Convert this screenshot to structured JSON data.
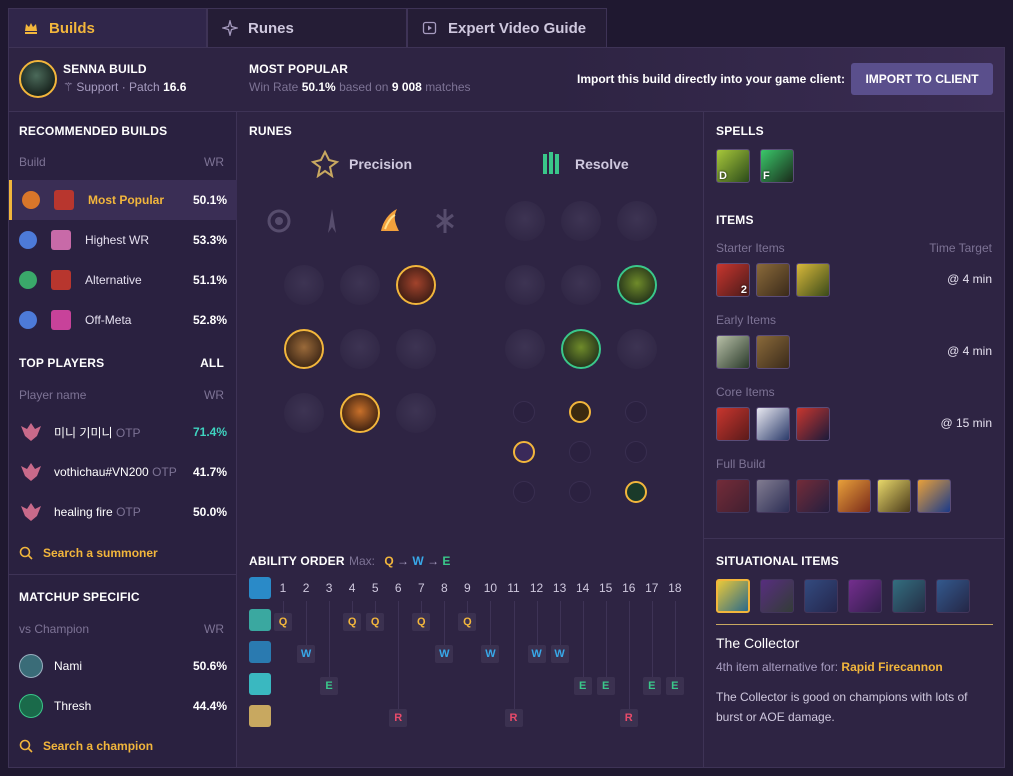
{
  "tabs": [
    {
      "label": "Builds",
      "icon": "crown-icon",
      "active": true
    },
    {
      "label": "Runes",
      "icon": "rune-icon",
      "active": false
    },
    {
      "label": "Expert Video Guide",
      "icon": "video-icon",
      "active": false
    }
  ],
  "header": {
    "champion_build": "SENNA BUILD",
    "role": "Support",
    "patch_label": "Patch",
    "patch": "16.6",
    "popular_title": "MOST POPULAR",
    "winrate_label": "Win Rate",
    "winrate": "50.1%",
    "based_on": "based on",
    "matches_count": "9 008",
    "matches_label": "matches",
    "import_text": "Import this build directly into your game client:",
    "import_button": "IMPORT TO CLIENT"
  },
  "recommended": {
    "title": "RECOMMENDED BUILDS",
    "col_build": "Build",
    "col_wr": "WR",
    "rows": [
      {
        "label": "Most Popular",
        "wr": "50.1%"
      },
      {
        "label": "Highest WR",
        "wr": "53.3%"
      },
      {
        "label": "Alternative",
        "wr": "51.1%"
      },
      {
        "label": "Off-Meta",
        "wr": "52.8%"
      }
    ]
  },
  "top_players": {
    "title": "TOP PLAYERS",
    "all_link": "ALL",
    "col_name": "Player name",
    "col_wr": "WR",
    "rows": [
      {
        "name": "미니 기미니",
        "tag": "OTP",
        "wr": "71.4%",
        "wr_color": "#3fd4c0"
      },
      {
        "name": "vothichau#VN200",
        "tag": "OTP",
        "wr": "41.7%",
        "wr_color": "#ffffff"
      },
      {
        "name": "healing fire",
        "tag": "OTP",
        "wr": "50.0%",
        "wr_color": "#ffffff"
      }
    ],
    "search": "Search a summoner"
  },
  "matchup": {
    "title": "MATCHUP SPECIFIC",
    "col_vs": "vs Champion",
    "col_wr": "WR",
    "rows": [
      {
        "name": "Nami",
        "wr": "50.6%"
      },
      {
        "name": "Thresh",
        "wr": "44.4%"
      }
    ],
    "search": "Search a champion"
  },
  "runes": {
    "title": "RUNES",
    "primary": "Precision",
    "secondary": "Resolve"
  },
  "ability": {
    "title": "ABILITY ORDER",
    "max_label": "Max:",
    "max_order": [
      "Q",
      "W",
      "E"
    ],
    "levels": [
      "1",
      "2",
      "3",
      "4",
      "5",
      "6",
      "7",
      "8",
      "9",
      "10",
      "11",
      "12",
      "13",
      "14",
      "15",
      "16",
      "17",
      "18"
    ]
  },
  "spells": {
    "title": "SPELLS",
    "keys": [
      "D",
      "F"
    ]
  },
  "items": {
    "title": "ITEMS",
    "starter_label": "Starter Items",
    "time_target_label": "Time Target",
    "starter_time": "@ 4 min",
    "starter_count": "2",
    "early_label": "Early Items",
    "early_time": "@ 4 min",
    "core_label": "Core Items",
    "core_time": "@ 15 min",
    "full_label": "Full Build"
  },
  "situational": {
    "title": "SITUATIONAL ITEMS",
    "item_name": "The Collector",
    "alt_prefix": "4th item alternative for:",
    "alt_item": "Rapid Firecannon",
    "description": "The Collector is good on champions with lots of burst or AOE damage."
  },
  "colors": {
    "accent": "#f2b63c",
    "panel": "#2e2443",
    "q": "#f2b63c",
    "w": "#38a8e8",
    "e": "#3ac78a",
    "r": "#e84a6a"
  }
}
